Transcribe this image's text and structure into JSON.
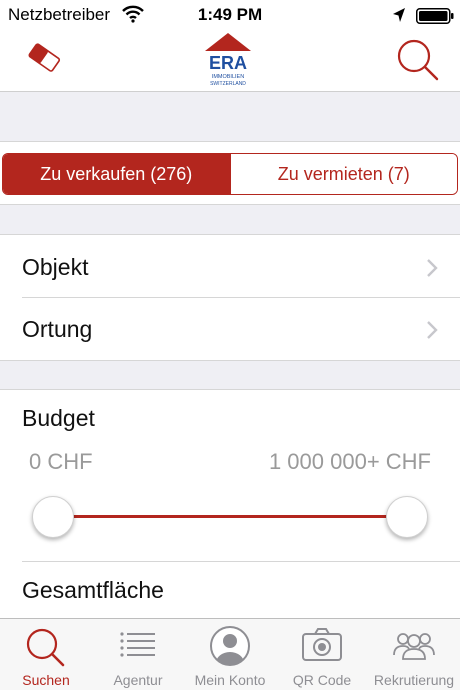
{
  "status": {
    "carrier": "Netzbetreiber",
    "time": "1:49 PM"
  },
  "header": {
    "logo_text": "ERA",
    "logo_sub1": "IMMOBILIEN",
    "logo_sub2": "SWITZERLAND",
    "left_icon": "eraser-icon",
    "right_icon": "search-icon"
  },
  "segments": [
    {
      "label": "Zu verkaufen (276)",
      "selected": true
    },
    {
      "label": "Zu vermieten (7)",
      "selected": false
    }
  ],
  "rows": [
    {
      "label": "Objekt"
    },
    {
      "label": "Ortung"
    }
  ],
  "budget": {
    "title": "Budget",
    "min_label": "0 CHF",
    "max_label": "1 000 000+ CHF"
  },
  "area_title": "Gesamtfläche",
  "tabs": [
    {
      "label": "Suchen",
      "icon": "search-icon",
      "active": true
    },
    {
      "label": "Agentur",
      "icon": "list-icon",
      "active": false
    },
    {
      "label": "Mein Konto",
      "icon": "person-icon",
      "active": false
    },
    {
      "label": "QR Code",
      "icon": "camera-icon",
      "active": false
    },
    {
      "label": "Rekrutierung",
      "icon": "group-icon",
      "active": false
    }
  ],
  "colors": {
    "accent": "#b3261e",
    "logo_blue": "#1f4fa0",
    "inactive": "#8e8e93"
  }
}
